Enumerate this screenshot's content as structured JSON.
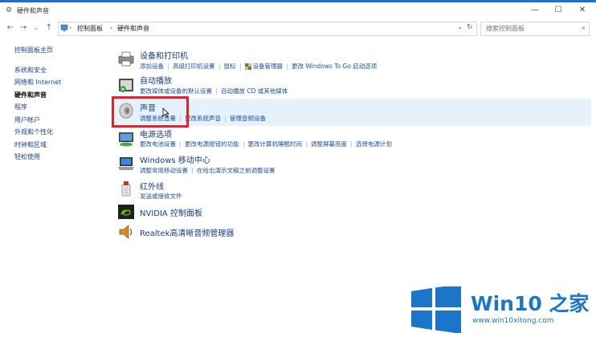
{
  "window": {
    "title": "硬件和声音"
  },
  "address": {
    "crumbs": [
      "控制面板",
      "硬件和声音"
    ],
    "search_placeholder": "搜索控制面板"
  },
  "sidebar": {
    "items": [
      {
        "label": "控制面板主页"
      },
      {
        "label": "系统和安全"
      },
      {
        "label": "网络和 Internet"
      },
      {
        "label": "硬件和声音"
      },
      {
        "label": "程序"
      },
      {
        "label": "用户帐户"
      },
      {
        "label": "外观和个性化"
      },
      {
        "label": "时钟和区域"
      },
      {
        "label": "轻松使用"
      }
    ]
  },
  "categories": [
    {
      "title": "设备和打印机",
      "links": [
        "添加设备",
        "高级打印机设置",
        "鼠标",
        "设备管理器",
        "更改 Windows To Go 启动选项"
      ]
    },
    {
      "title": "自动播放",
      "links": [
        "更改媒体或设备的默认设置",
        "自动播放 CD 或其他媒体"
      ]
    },
    {
      "title": "声音",
      "links": [
        "调整系统音量",
        "更改系统声音",
        "管理音频设备"
      ]
    },
    {
      "title": "电源选项",
      "links": [
        "更改电池设置",
        "更改电源按钮的功能",
        "更改计算机睡眠时间",
        "调整屏幕亮度",
        "选择电源计划"
      ]
    },
    {
      "title": "Windows 移动中心",
      "links": [
        "调整常用移动设置",
        "在给出演示文稿之前调整设置"
      ]
    },
    {
      "title": "红外线",
      "links": [
        "发送或接收文件"
      ]
    },
    {
      "title": "NVIDIA 控制面板",
      "links": []
    },
    {
      "title": "Realtek高清晰音频管理器",
      "links": []
    }
  ],
  "watermark": {
    "brand": "Win10 之家",
    "url": "www.win10xitong.com"
  },
  "colors": {
    "link": "#1b4fa8",
    "highlight": "#e5f1fb",
    "annotation_box": "#e8202a",
    "logo_blue": "#1b75c9"
  }
}
